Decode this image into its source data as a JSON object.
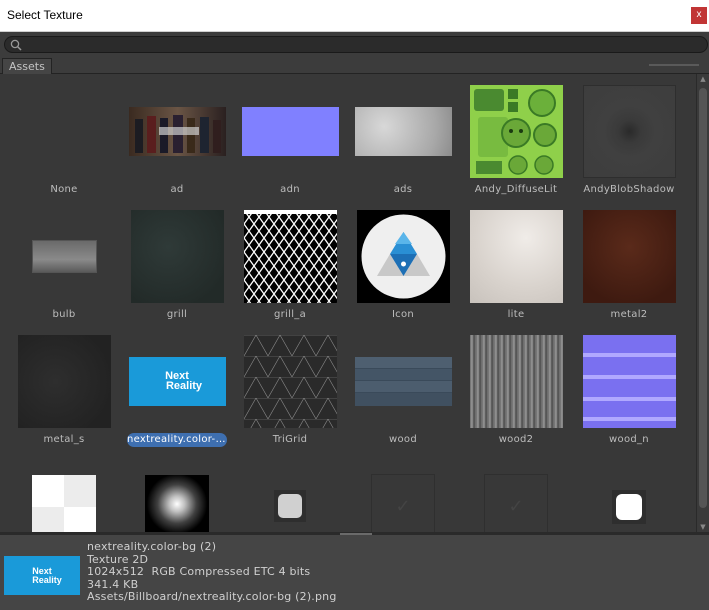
{
  "window": {
    "title": "Select Texture",
    "close_label": "x"
  },
  "search": {
    "value": "",
    "placeholder": ""
  },
  "tabs": [
    {
      "label": "Assets"
    }
  ],
  "textures": [
    {
      "name": "None"
    },
    {
      "name": "ad"
    },
    {
      "name": "adn"
    },
    {
      "name": "ads"
    },
    {
      "name": "Andy_DiffuseLit"
    },
    {
      "name": "AndyBlobShadow"
    },
    {
      "name": "bulb"
    },
    {
      "name": "grill"
    },
    {
      "name": "grill_a"
    },
    {
      "name": "Icon"
    },
    {
      "name": "lite"
    },
    {
      "name": "metal2"
    },
    {
      "name": "metal_s"
    },
    {
      "name": "nextreality.color-bg (2)",
      "selected": true
    },
    {
      "name": "TriGrid"
    },
    {
      "name": "wood"
    },
    {
      "name": "wood2"
    },
    {
      "name": "wood_n"
    }
  ],
  "preview": {
    "name": "nextreality.color-bg (2)",
    "type": "Texture 2D",
    "format": "1024x512  RGB Compressed ETC 4 bits",
    "size": "341.4 KB",
    "path": "Assets/Billboard/nextreality.color-bg (2).png",
    "logo_line1": "Next",
    "logo_line2": "Reality"
  },
  "colors": {
    "accent": "#3e6fb0",
    "logo_bg": "#1a9ad9",
    "close": "#c13535"
  }
}
